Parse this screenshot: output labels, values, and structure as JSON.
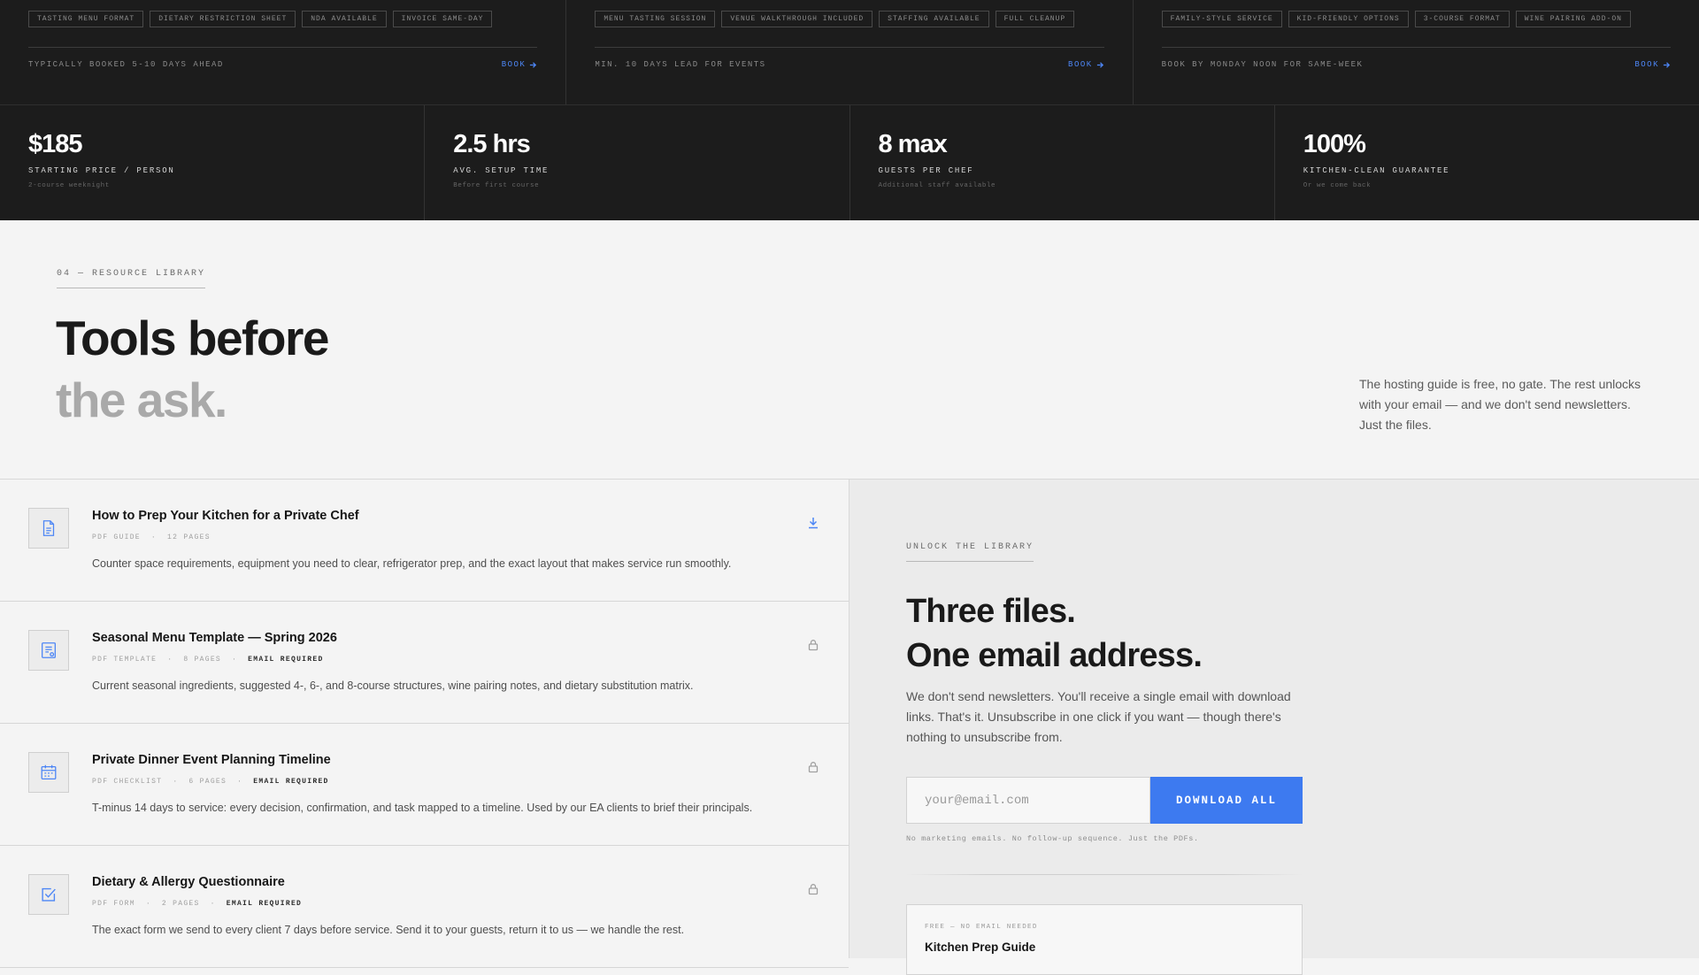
{
  "services": [
    {
      "tags": [
        "TASTING MENU FORMAT",
        "DIETARY RESTRICTION SHEET",
        "NDA AVAILABLE",
        "INVOICE SAME-DAY"
      ],
      "note": "TYPICALLY BOOKED 5-10 DAYS AHEAD",
      "book_label": "BOOK"
    },
    {
      "tags": [
        "MENU TASTING SESSION",
        "VENUE WALKTHROUGH INCLUDED",
        "STAFFING AVAILABLE",
        "FULL CLEANUP"
      ],
      "note": "MIN. 10 DAYS LEAD FOR EVENTS",
      "book_label": "BOOK"
    },
    {
      "tags": [
        "FAMILY-STYLE SERVICE",
        "KID-FRIENDLY OPTIONS",
        "3-COURSE FORMAT",
        "WINE PAIRING ADD-ON"
      ],
      "note": "BOOK BY MONDAY NOON FOR SAME-WEEK",
      "book_label": "BOOK"
    }
  ],
  "stats": [
    {
      "value": "$185",
      "label": "STARTING PRICE / PERSON",
      "sub": "2-course weeknight"
    },
    {
      "value": "2.5 hrs",
      "label": "AVG. SETUP TIME",
      "sub": "Before first course"
    },
    {
      "value": "8 max",
      "label": "GUESTS PER CHEF",
      "sub": "Additional staff available"
    },
    {
      "value": "100%",
      "label": "KITCHEN-CLEAN GUARANTEE",
      "sub": "Or we come back"
    }
  ],
  "library": {
    "eyebrow": "04 — RESOURCE LIBRARY",
    "title_line1": "Tools before",
    "title_line2": "the ask.",
    "intro": "The hosting guide is free, no gate. The rest unlocks with your email — and we don't send newsletters. Just the files."
  },
  "files": [
    {
      "title": "How to Prep Your Kitchen for a Private Chef",
      "type": "PDF GUIDE",
      "pages": "12 PAGES",
      "requirement": "",
      "description": "Counter space requirements, equipment you need to clear, refrigerator prep, and the exact layout that makes service run smoothly.",
      "icon": "document-icon",
      "action": "download-icon"
    },
    {
      "title": "Seasonal Menu Template — Spring 2026",
      "type": "PDF TEMPLATE",
      "pages": "8 PAGES",
      "requirement": "EMAIL REQUIRED",
      "description": "Current seasonal ingredients, suggested 4-, 6-, and 8-course structures, wine pairing notes, and dietary substitution matrix.",
      "icon": "template-icon",
      "action": "lock-icon"
    },
    {
      "title": "Private Dinner Event Planning Timeline",
      "type": "PDF CHECKLIST",
      "pages": "6 PAGES",
      "requirement": "EMAIL REQUIRED",
      "description": "T-minus 14 days to service: every decision, confirmation, and task mapped to a timeline. Used by our EA clients to brief their principals.",
      "icon": "calendar-icon",
      "action": "lock-icon"
    },
    {
      "title": "Dietary & Allergy Questionnaire",
      "type": "PDF FORM",
      "pages": "2 PAGES",
      "requirement": "EMAIL REQUIRED",
      "description": "The exact form we send to every client 7 days before service. Send it to your guests, return it to us — we handle the rest.",
      "icon": "checkbox-icon",
      "action": "lock-icon"
    }
  ],
  "unlock": {
    "eyebrow": "UNLOCK THE LIBRARY",
    "title_line1": "Three files.",
    "title_line2": "One email address.",
    "body": "We don't send newsletters. You'll receive a single email with download links. That's it. Unsubscribe in one click if you want — though there's nothing to unsubscribe from.",
    "email_placeholder": "your@email.com",
    "email_value": "",
    "button_label": "DOWNLOAD ALL",
    "fine_print": "No marketing emails. No follow-up sequence. Just the PDFs.",
    "free_card": {
      "tag": "FREE — NO EMAIL NEEDED",
      "title": "Kitchen Prep Guide"
    }
  },
  "colors": {
    "accent": "#3d7af0",
    "dark_bg": "#1c1c1c",
    "light_bg": "#f4f4f4",
    "panel_bg": "#ebebeb"
  }
}
